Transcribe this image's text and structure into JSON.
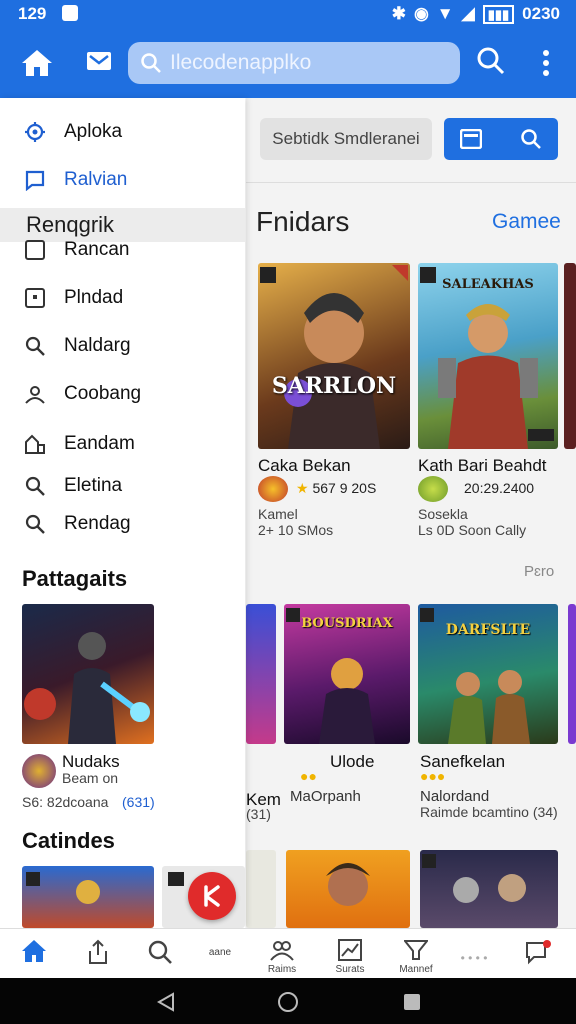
{
  "status": {
    "time": "129",
    "right": "0230"
  },
  "appbar": {
    "search_text": "Ilecodenapplko"
  },
  "filter": {
    "field_text": "Sebtidk Smdleranei"
  },
  "sections": {
    "title": "Fnidars",
    "link": "Gamee",
    "more": "Pɛro"
  },
  "cards_row1": [
    {
      "name": "Caka Bekan",
      "rating": "567 9 20S",
      "line1": "Kamel",
      "line2": "2+ 10 SMos",
      "art": "SARRLON"
    },
    {
      "name": "Kath Bari Beahdt",
      "rating": "20:29.2400",
      "line1": "Sosekla",
      "line2": "Ls 0D Soon Cally",
      "art": "SALEAKHAS"
    }
  ],
  "cards_row2": [
    {
      "name": "Ulode",
      "rating": "",
      "line1": "MaOrpanh",
      "line2": "",
      "art": "BOUSDRIAX"
    },
    {
      "name": "Sanefkelan",
      "rating": "",
      "line1": "Nalordand",
      "line2": "Raimde bcamtino  (34)",
      "art": "DARFSLTE"
    }
  ],
  "left_partial": {
    "name": "Kem",
    "line": "(31)"
  },
  "drawer": {
    "items": [
      {
        "label": "Aploka",
        "active": false
      },
      {
        "label": "Ralvian",
        "active": true
      }
    ],
    "header": "Renqgrik",
    "items2": [
      {
        "label": "Rancan"
      },
      {
        "label": "Plndad"
      },
      {
        "label": "Naldarg"
      },
      {
        "label": "Coobang"
      },
      {
        "label": "Eandam"
      },
      {
        "label": "Eletina"
      },
      {
        "label": "Rendag"
      }
    ],
    "section1": "Pattagaits",
    "featured": {
      "title": "Nudaks",
      "sub": "Beam on",
      "line": "S6: 82dcoana",
      "rating": "(631)"
    },
    "section2": "Catindes"
  },
  "bottomnav": [
    {
      "label": ""
    },
    {
      "label": ""
    },
    {
      "label": ""
    },
    {
      "label": "aane"
    },
    {
      "label": "Raims"
    },
    {
      "label": "Surats"
    },
    {
      "label": "Mannef"
    },
    {
      "label": ""
    },
    {
      "label": ""
    }
  ],
  "colors": {
    "primary": "#1f6fe0",
    "fab": "#e02b2b",
    "drawer_bg": "#ffffff"
  }
}
